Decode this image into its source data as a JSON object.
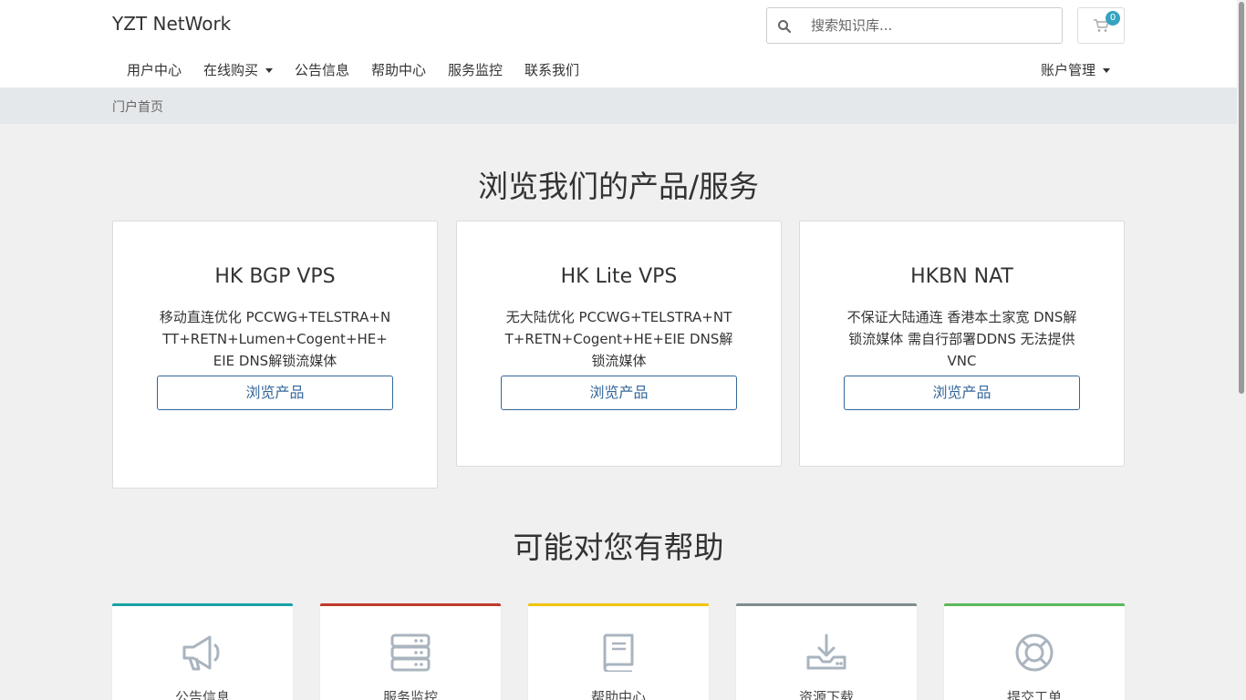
{
  "header": {
    "brand": "YZT NetWork",
    "search_placeholder": "搜索知识库...",
    "cart_count": "0"
  },
  "nav": {
    "left": [
      "用户中心",
      "在线购买",
      "公告信息",
      "帮助中心",
      "服务监控",
      "联系我们"
    ],
    "right": "账户管理"
  },
  "breadcrumb": "门户首页",
  "products_section": {
    "title": "浏览我们的产品/服务",
    "cards": [
      {
        "name": "HK BGP VPS",
        "desc": "移动直连优化 PCCWG+TELSTRA+NTT+RETN+Lumen+Cogent+HE+EIE DNS解锁流媒体",
        "button": "浏览产品"
      },
      {
        "name": "HK Lite VPS",
        "desc": "无大陆优化 PCCWG+TELSTRA+NTT+RETN+Cogent+HE+EIE DNS解锁流媒体",
        "button": "浏览产品"
      },
      {
        "name": "HKBN NAT",
        "desc": "不保证大陆通连 香港本土家宽 DNS解锁流媒体 需自行部署DDNS 无法提供VNC",
        "button": "浏览产品"
      }
    ]
  },
  "help_section": {
    "title": "可能对您有帮助",
    "tiles": [
      {
        "label": "公告信息",
        "icon": "megaphone-icon",
        "color": "#17a2a6"
      },
      {
        "label": "服务监控",
        "icon": "server-icon",
        "color": "#c0392b"
      },
      {
        "label": "帮助中心",
        "icon": "book-icon",
        "color": "#f1c40f"
      },
      {
        "label": "资源下载",
        "icon": "download-icon",
        "color": "#7f8c8d"
      },
      {
        "label": "提交工单",
        "icon": "lifebuoy-icon",
        "color": "#5cb85c"
      }
    ]
  },
  "colors": {
    "accent": "#336699",
    "badge": "#36a3c0",
    "breadcrumb_bg": "#e5e8eb"
  }
}
